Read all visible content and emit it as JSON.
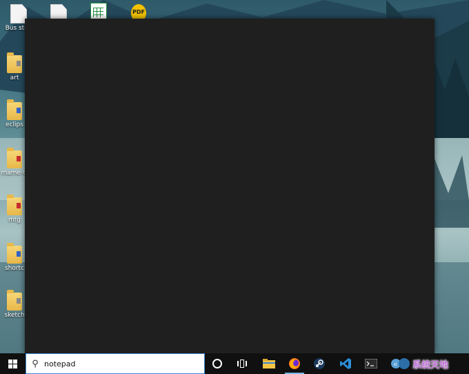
{
  "desktop": {
    "icons": [
      {
        "label": "Bus stop",
        "kind": "file"
      },
      {
        "label": "",
        "kind": "file"
      },
      {
        "label": "",
        "kind": "spreadsheet"
      },
      {
        "label": "PDF",
        "kind": "pdf"
      },
      {
        "label": "",
        "kind": "vlc"
      },
      {
        "label": "art",
        "kind": "folder"
      },
      {
        "label": "eclips",
        "kind": "folder"
      },
      {
        "label": "mame-tr",
        "kind": "folder"
      },
      {
        "label": "mtg",
        "kind": "folder"
      },
      {
        "label": "shortc",
        "kind": "folder"
      },
      {
        "label": "sketch",
        "kind": "folder"
      }
    ]
  },
  "search": {
    "value": "notepad",
    "icon": "search-icon"
  },
  "taskbar": {
    "items": [
      {
        "name": "start",
        "icon": "windows-logo-icon"
      },
      {
        "name": "cortana",
        "icon": "cortana-circle-icon"
      },
      {
        "name": "task-view",
        "icon": "task-view-icon"
      },
      {
        "name": "file-explorer",
        "icon": "folder-icon"
      },
      {
        "name": "firefox",
        "icon": "firefox-icon",
        "active": true
      },
      {
        "name": "steam",
        "icon": "steam-icon"
      },
      {
        "name": "vscode",
        "icon": "vscode-icon"
      },
      {
        "name": "terminal",
        "icon": "terminal-icon"
      }
    ]
  },
  "watermark": {
    "text": "系统天地"
  },
  "colors": {
    "taskbar": "#101010",
    "start_panel": "#1f1f1f",
    "search_border": "#3a86d6",
    "accent": "#78b7e8"
  }
}
